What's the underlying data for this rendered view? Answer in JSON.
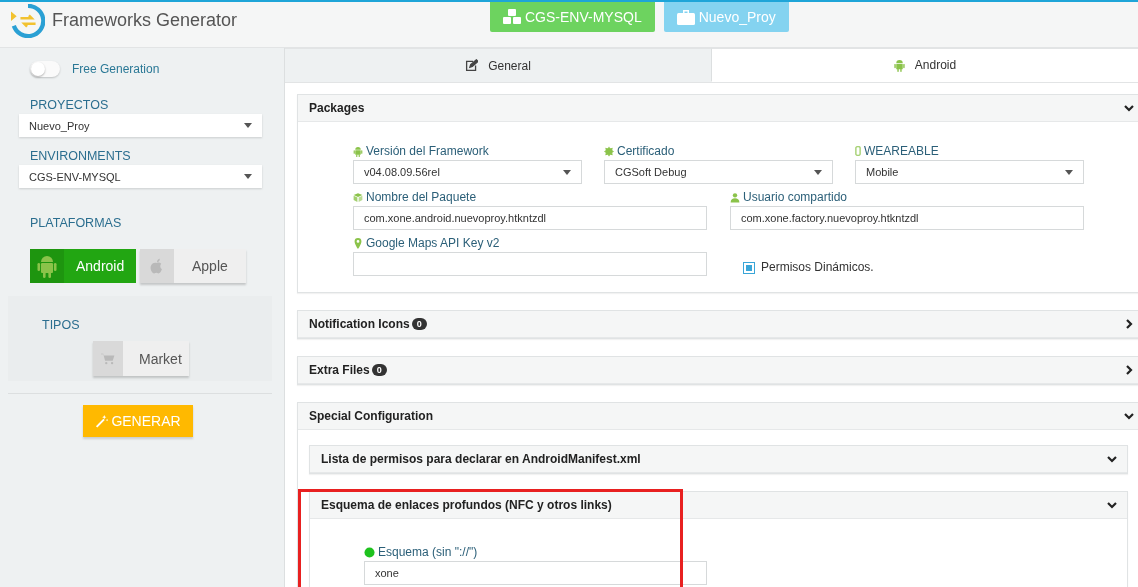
{
  "app": {
    "title": "Frameworks Generator"
  },
  "header_badges": [
    {
      "kind": "environment",
      "label": "CGS-ENV-MYSQL"
    },
    {
      "kind": "project",
      "label": "Nuevo_Proy"
    }
  ],
  "sidebar": {
    "free_generation": {
      "label": "Free Generation",
      "on": false
    },
    "selects": [
      {
        "label": "PROYECTOS",
        "value": "Nuevo_Proy"
      },
      {
        "label": "ENVIRONMENTS",
        "value": "CGS-ENV-MYSQL"
      }
    ],
    "platforms_label": "PLATAFORMAS",
    "platforms": [
      {
        "kind": "android",
        "label": "Android",
        "selected": true
      },
      {
        "kind": "apple",
        "label": "Apple",
        "selected": false
      }
    ],
    "types_label": "TIPOS",
    "types": [
      {
        "kind": "cart",
        "label": "Market",
        "selected": false
      }
    ],
    "generate_button": "GENERAR"
  },
  "tabs": [
    {
      "kind": "edit",
      "label": "General",
      "selected": false
    },
    {
      "kind": "android",
      "label": "Android",
      "selected": true
    }
  ],
  "panels": [
    {
      "title": "Packages",
      "expanded": true,
      "rows": [
        [
          {
            "kind": "select",
            "label": "Versión del Framework",
            "value": "v04.08.09.56rel"
          },
          {
            "kind": "select",
            "label": "Certificado",
            "value": "CGSoft Debug"
          },
          {
            "kind": "select",
            "label": "WEAREABLE",
            "value": "Mobile"
          }
        ],
        [
          {
            "kind": "text",
            "label": "Nombre del Paquete",
            "value": "com.xone.android.nuevoproy.htkntzdl"
          },
          {
            "kind": "text",
            "label": "Usuario compartido",
            "value": "com.xone.factory.nuevoproy.htkntzdl"
          }
        ],
        [
          {
            "kind": "text",
            "label": "Google Maps API Key v2"
          },
          {
            "kind": "checkbox",
            "label": "Permisos Dinámicos.",
            "checked": true
          }
        ]
      ]
    },
    {
      "title": "Notification Icons",
      "badge": "0",
      "expanded": false
    },
    {
      "title": "Extra Files",
      "badge": "0",
      "expanded": false
    },
    {
      "title": "Special Configuration",
      "expanded": true,
      "children": [
        {
          "title": "Lista de permisos para declarar en AndroidManifest.xml",
          "expanded": true
        },
        {
          "title": "Esquema de enlaces profundos (NFC y otros links)",
          "expanded": true,
          "highlighted": true,
          "rows": [
            [
              {
                "kind": "text",
                "label": "Esquema (sin \"://\")",
                "value": "xone"
              }
            ]
          ]
        }
      ]
    }
  ]
}
